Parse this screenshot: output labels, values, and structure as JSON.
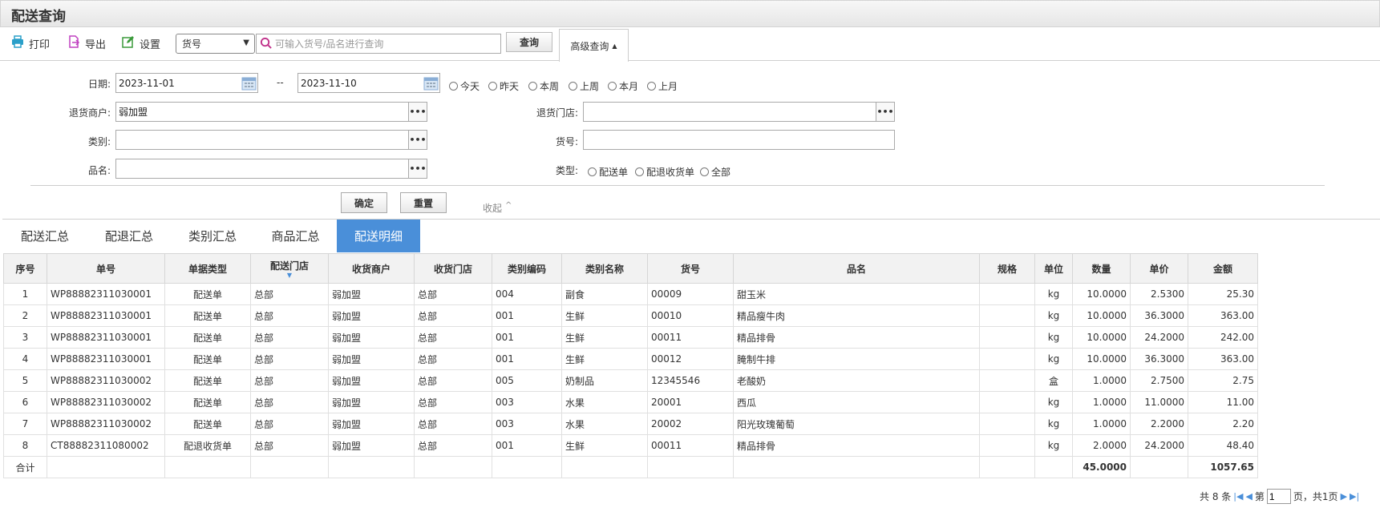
{
  "title": "配送查询",
  "toolbar": {
    "print_label": "打印",
    "export_label": "导出",
    "settings_label": "设置",
    "search_field_value": "货号",
    "search_placeholder": "可输入货号/品名进行查询",
    "query_label": "查询",
    "advanced_label": "高级查询"
  },
  "filters": {
    "date_label": "日期:",
    "date_from": "2023-11-01",
    "date_sep": "--",
    "date_to": "2023-11-10",
    "quick_dates": [
      "今天",
      "昨天",
      "本周",
      "上周",
      "本月",
      "上月"
    ],
    "return_merchant_label": "退货商户:",
    "return_merchant_value": "弱加盟",
    "return_store_label": "退货门店:",
    "return_store_value": "",
    "category_label": "类别:",
    "category_value": "",
    "item_no_label": "货号:",
    "item_no_value": "",
    "item_name_label": "品名:",
    "item_name_value": "",
    "type_label": "类型:",
    "types": [
      "配送单",
      "配退收货单",
      "全部"
    ],
    "confirm_label": "确定",
    "reset_label": "重置",
    "collapse_label": "收起"
  },
  "tabs": [
    "配送汇总",
    "配退汇总",
    "类别汇总",
    "商品汇总",
    "配送明细"
  ],
  "active_tab": 4,
  "table": {
    "headers": [
      "序号",
      "单号",
      "单据类型",
      "配送门店",
      "收货商户",
      "收货门店",
      "类别编码",
      "类别名称",
      "货号",
      "品名",
      "规格",
      "单位",
      "数量",
      "单价",
      "金额"
    ],
    "rows": [
      [
        "1",
        "WP88882311030001",
        "配送单",
        "总部",
        "弱加盟",
        "总部",
        "004",
        "副食",
        "00009",
        "甜玉米",
        "",
        "kg",
        "10.0000",
        "2.5300",
        "25.30"
      ],
      [
        "2",
        "WP88882311030001",
        "配送单",
        "总部",
        "弱加盟",
        "总部",
        "001",
        "生鲜",
        "00010",
        "精品瘦牛肉",
        "",
        "kg",
        "10.0000",
        "36.3000",
        "363.00"
      ],
      [
        "3",
        "WP88882311030001",
        "配送单",
        "总部",
        "弱加盟",
        "总部",
        "001",
        "生鲜",
        "00011",
        "精品排骨",
        "",
        "kg",
        "10.0000",
        "24.2000",
        "242.00"
      ],
      [
        "4",
        "WP88882311030001",
        "配送单",
        "总部",
        "弱加盟",
        "总部",
        "001",
        "生鲜",
        "00012",
        "腌制牛排",
        "",
        "kg",
        "10.0000",
        "36.3000",
        "363.00"
      ],
      [
        "5",
        "WP88882311030002",
        "配送单",
        "总部",
        "弱加盟",
        "总部",
        "005",
        "奶制品",
        "12345546",
        "老酸奶",
        "",
        "盒",
        "1.0000",
        "2.7500",
        "2.75"
      ],
      [
        "6",
        "WP88882311030002",
        "配送单",
        "总部",
        "弱加盟",
        "总部",
        "003",
        "水果",
        "20001",
        "西瓜",
        "",
        "kg",
        "1.0000",
        "11.0000",
        "11.00"
      ],
      [
        "7",
        "WP88882311030002",
        "配送单",
        "总部",
        "弱加盟",
        "总部",
        "003",
        "水果",
        "20002",
        "阳光玫瑰葡萄",
        "",
        "kg",
        "1.0000",
        "2.2000",
        "2.20"
      ],
      [
        "8",
        "CT88882311080002",
        "配退收货单",
        "总部",
        "弱加盟",
        "总部",
        "001",
        "生鲜",
        "00011",
        "精品排骨",
        "",
        "kg",
        "2.0000",
        "24.2000",
        "48.40"
      ]
    ],
    "footer_label": "合计",
    "total_qty": "45.0000",
    "total_amount": "1057.65"
  },
  "pager": {
    "total_text": "共 8 条",
    "page_prefix": "第",
    "page_value": "1",
    "page_suffix": "页，共1页"
  }
}
